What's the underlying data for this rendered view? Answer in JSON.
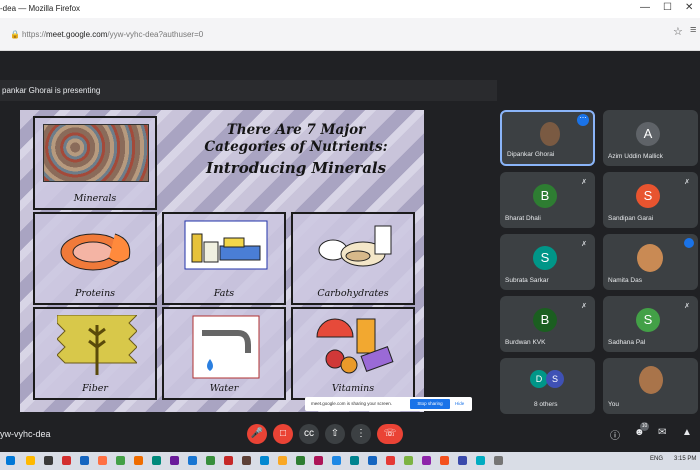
{
  "window": {
    "title": "-dea — Mozilla Firefox"
  },
  "browser": {
    "url_prefix": "https://",
    "url_domain": "meet.google.com",
    "url_path": "/yyw-vyhc-dea?authuser=0"
  },
  "meeting": {
    "presenting_text": "pankar Ghorai is presenting",
    "code": "yw-vyhc-dea"
  },
  "slide": {
    "title_lines": [
      "There Are 7 Major",
      "Categories of Nutrients:",
      "Introducing Minerals"
    ],
    "labels": [
      "Minerals",
      "Proteins",
      "Fats",
      "Carbohydrates",
      "Fiber",
      "Water",
      "Vitamins"
    ]
  },
  "participants": [
    {
      "name": "Dipankar Ghorai",
      "type": "photo",
      "highlight": true
    },
    {
      "name": "Azim Uddin Mallick",
      "initial": "A",
      "color": "#5f6368"
    },
    {
      "name": "Bharat Dhali",
      "initial": "B",
      "color": "#2e7d32",
      "muted": true
    },
    {
      "name": "Sandipan Garai",
      "initial": "S",
      "color": "#e8542f",
      "muted": true
    },
    {
      "name": "Subrata Sarkar",
      "initial": "S",
      "color": "#009688",
      "muted": true
    },
    {
      "name": "Namita Das",
      "type": "photo",
      "speaking": true
    },
    {
      "name": "Burdwan KVK",
      "initial": "B",
      "color": "#1b5e20",
      "muted": true
    },
    {
      "name": "Sadhana Pal",
      "initial": "S",
      "color": "#43a047",
      "muted": true
    },
    {
      "name": "8 others",
      "initials": [
        "D",
        "S"
      ]
    },
    {
      "name": "You",
      "type": "photo"
    }
  ],
  "share_notice": {
    "text": "meet.google.com is sharing your screen.",
    "stop_label": "Stop sharing",
    "hide_label": "Hide"
  },
  "controls": {
    "people_count": "10"
  },
  "taskbar": {
    "lang": "ENG",
    "time": "3:15 PM"
  },
  "colors": {
    "background": "#202124",
    "tile": "#3c4043",
    "end_call": "#ea4335",
    "accent": "#1a73e8"
  }
}
